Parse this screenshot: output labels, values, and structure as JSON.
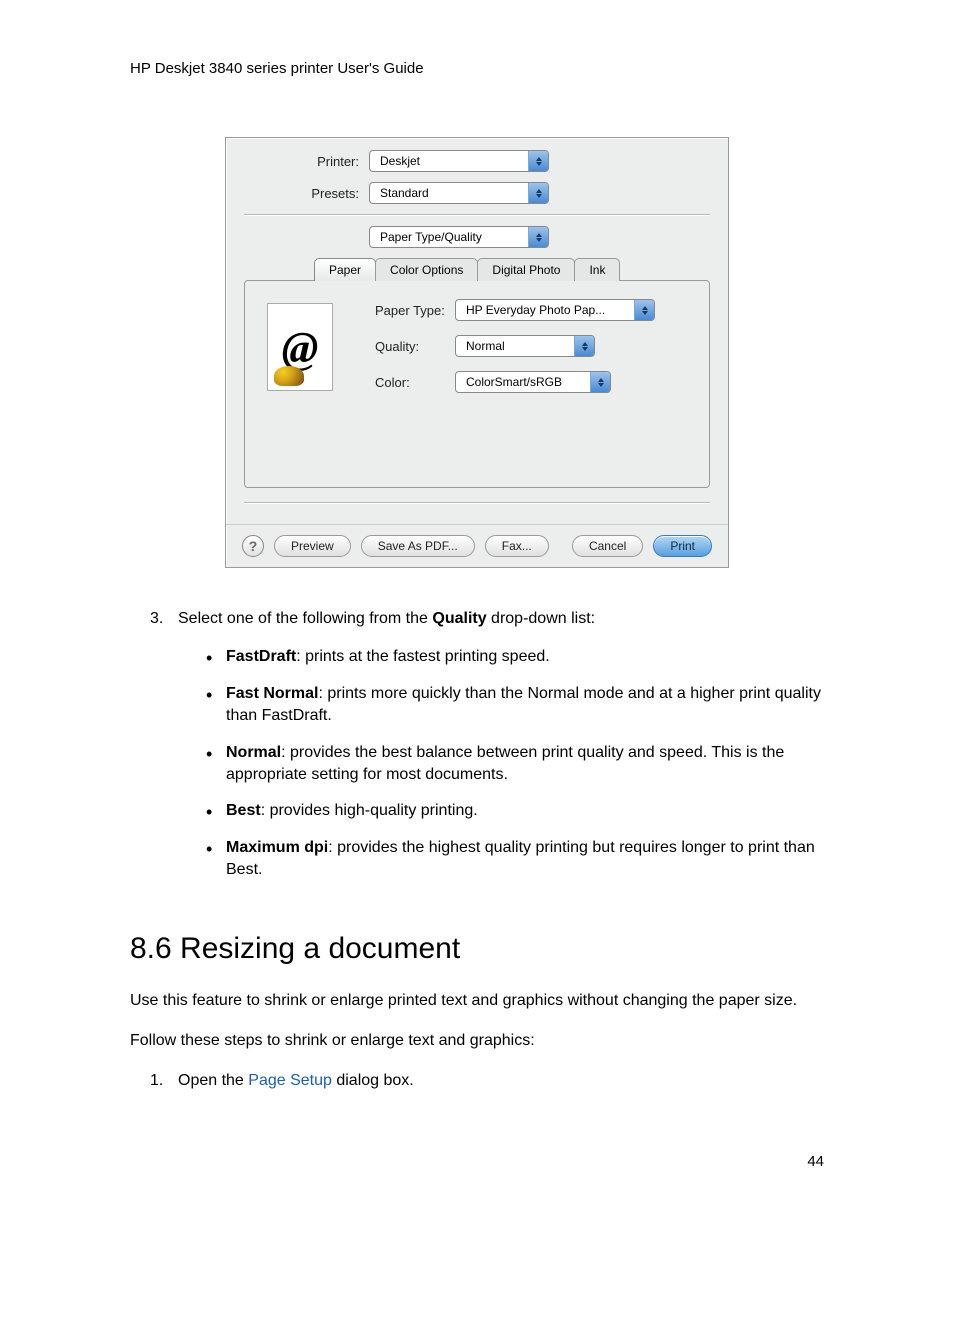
{
  "header": "HP Deskjet 3840 series printer User's Guide",
  "dialog": {
    "printer_label": "Printer:",
    "printer_value": "Deskjet",
    "presets_label": "Presets:",
    "presets_value": "Standard",
    "panel_value": "Paper Type/Quality",
    "tabs": [
      "Paper",
      "Color Options",
      "Digital Photo",
      "Ink"
    ],
    "paper_type_label": "Paper Type:",
    "paper_type_value": "HP Everyday Photo Pap...",
    "quality_label": "Quality:",
    "quality_value": "Normal",
    "color_label": "Color:",
    "color_value": "ColorSmart/sRGB",
    "buttons": {
      "help": "?",
      "preview": "Preview",
      "save_pdf": "Save As PDF...",
      "fax": "Fax...",
      "cancel": "Cancel",
      "print": "Print"
    }
  },
  "step3": {
    "number": "3.",
    "intro_a": "Select one of the following from the ",
    "intro_bold": "Quality",
    "intro_b": " drop-down list:",
    "bullets": [
      {
        "bold": "FastDraft",
        "text": ": prints at the fastest printing speed."
      },
      {
        "bold": "Fast Normal",
        "text": ": prints more quickly than the Normal mode and at a higher print quality than FastDraft."
      },
      {
        "bold": "Normal",
        "text": ": provides the best balance between print quality and speed. This is the appropriate setting for most documents."
      },
      {
        "bold": "Best",
        "text": ": provides high-quality printing."
      },
      {
        "bold": "Maximum dpi",
        "text": ": provides the highest quality printing but requires longer to print than Best."
      }
    ]
  },
  "section": {
    "heading": "8.6  Resizing a document",
    "p1": "Use this feature to shrink or enlarge printed text and graphics without changing the paper size.",
    "p2": "Follow these steps to shrink or enlarge text and graphics:",
    "step1_num": "1.",
    "step1_a": "Open the ",
    "step1_link": "Page Setup",
    "step1_b": " dialog box."
  },
  "page_number": "44"
}
